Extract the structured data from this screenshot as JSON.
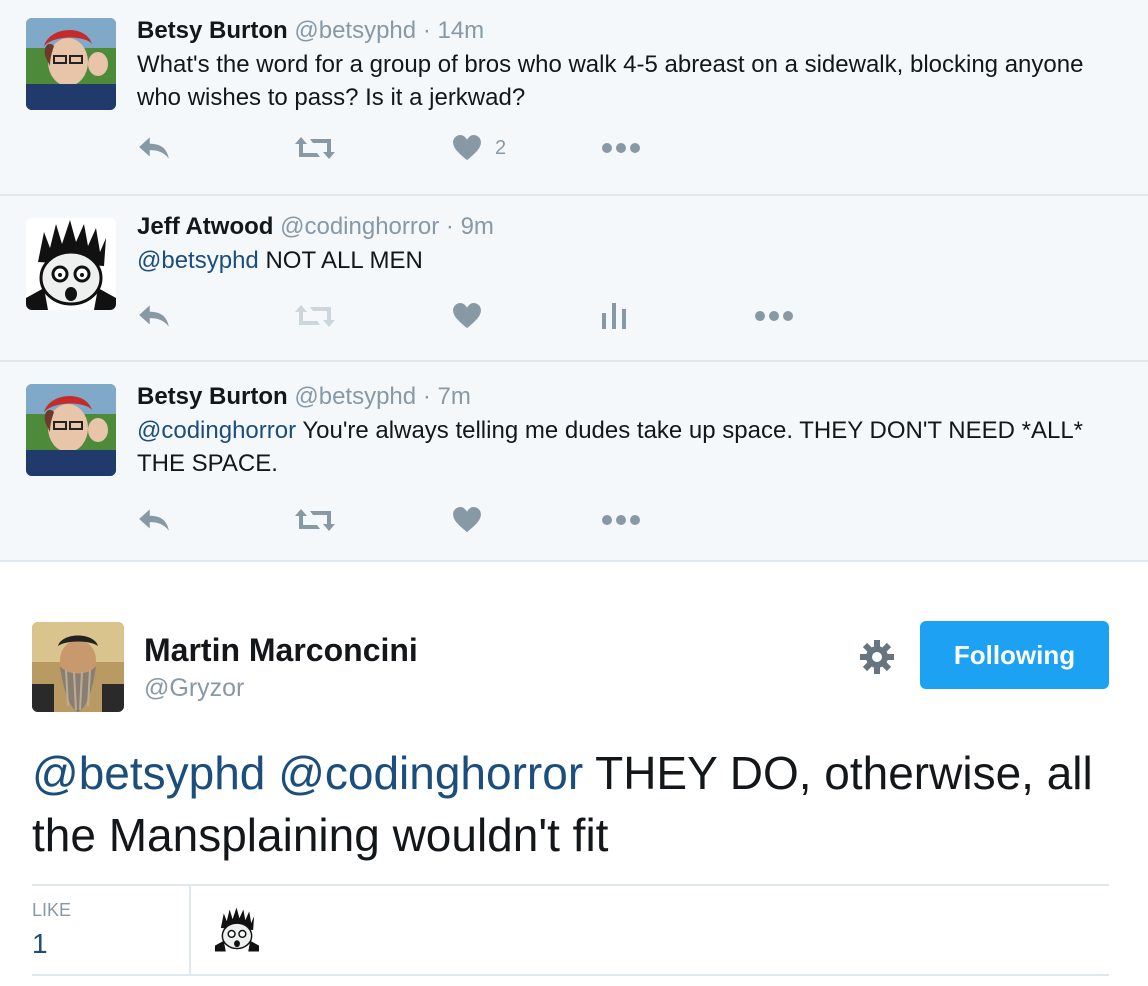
{
  "thread": [
    {
      "name": "Betsy Burton",
      "handle": "@betsyphd",
      "separator": "·",
      "time": "14m",
      "text_mention": "",
      "text": "What's the word for a group of bros who walk 4-5 abreast on a sidewalk, blocking anyone who wishes to pass? Is it a jerkwad?",
      "like_count": "2"
    },
    {
      "name": "Jeff Atwood",
      "handle": "@codinghorror",
      "separator": "·",
      "time": "9m",
      "text_mention": "@betsyphd",
      "text": " NOT ALL MEN",
      "like_count": ""
    },
    {
      "name": "Betsy Burton",
      "handle": "@betsyphd",
      "separator": "·",
      "time": "7m",
      "text_mention": "@codinghorror",
      "text": " You're always telling me dudes take up space. THEY DON'T NEED *ALL* THE SPACE.",
      "like_count": ""
    }
  ],
  "main_tweet": {
    "name": "Martin Marconcini",
    "handle": "@Gryzor",
    "follow_label": "Following",
    "mention_1": "@betsyphd",
    "mention_2": "@codinghorror",
    "text": " THEY DO, otherwise, all the Mansplaining wouldn't fit",
    "like_label": "LIKE",
    "like_count": "1"
  },
  "colors": {
    "accent": "#1da1f2",
    "mention": "#1b4e7d",
    "muted": "#8899a6",
    "thread_bg": "#f5f8fa"
  },
  "icons": [
    "reply-icon",
    "retweet-icon",
    "heart-icon",
    "analytics-icon",
    "more-icon",
    "gear-icon"
  ]
}
